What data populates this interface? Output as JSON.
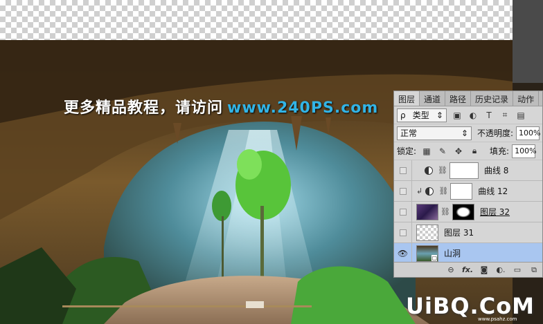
{
  "headline": {
    "text": "更多精品教程，请访问",
    "url": "www.240PS.com"
  },
  "watermark": {
    "brand": "UiBQ.CoM",
    "small": "www.psahz.com"
  },
  "colors": {
    "url_blue": "#32b4e6",
    "selected_layer": "#a9c6f0",
    "panel_bg": "#d6d6d6"
  },
  "panel": {
    "tabs": [
      {
        "label": "图层",
        "active": true
      },
      {
        "label": "通道",
        "active": false
      },
      {
        "label": "路径",
        "active": false
      },
      {
        "label": "历史记录",
        "active": false
      },
      {
        "label": "动作",
        "active": false
      }
    ],
    "filter": {
      "kind_label": "类型",
      "search_glyph": "ρ"
    },
    "filter_icons": [
      "image-filter-icon",
      "adjustment-filter-icon",
      "type-filter-icon",
      "shape-filter-icon",
      "smart-object-filter-icon"
    ],
    "blend_mode": "正常",
    "opacity_label": "不透明度:",
    "opacity_value": "100%",
    "lock_label": "锁定:",
    "fill_label": "填充:",
    "fill_value": "100%",
    "layers": [
      {
        "name": "曲线 8",
        "type": "adjustment",
        "visible": false,
        "clipped": false,
        "selected": false
      },
      {
        "name": "曲线 12",
        "type": "adjustment",
        "visible": false,
        "clipped": true,
        "selected": false
      },
      {
        "name": "图层 32",
        "type": "masked-photo",
        "visible": false,
        "clipped": false,
        "selected": false
      },
      {
        "name": "图层 31",
        "type": "empty",
        "visible": false,
        "clipped": false,
        "selected": false
      },
      {
        "name": "山洞",
        "type": "smart-photo",
        "visible": true,
        "clipped": false,
        "selected": true
      }
    ],
    "footer_icons": [
      "link-icon",
      "fx-icon",
      "mask-icon",
      "adjustment-icon",
      "group-icon",
      "new-layer-icon"
    ]
  }
}
